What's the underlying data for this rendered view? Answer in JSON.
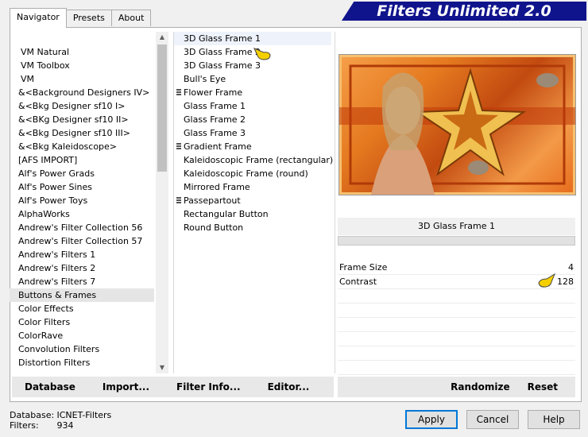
{
  "tabs": [
    {
      "label": "Navigator"
    },
    {
      "label": "Presets"
    },
    {
      "label": "About"
    }
  ],
  "banner": {
    "title": "Filters Unlimited 2.0"
  },
  "categories": [
    "VM Natural",
    "VM Toolbox",
    "VM",
    "&<Background Designers IV>",
    "&<Bkg Designer sf10 I>",
    "&<BKg Designer sf10 II>",
    "&<Bkg Designer sf10 III>",
    "&<Bkg Kaleidoscope>",
    "[AFS IMPORT]",
    "Alf's Power Grads",
    "Alf's Power Sines",
    "Alf's Power Toys",
    "AlphaWorks",
    "Andrew's Filter Collection 56",
    "Andrew's Filter Collection 57",
    "Andrew's Filters 1",
    "Andrew's Filters 2",
    "Andrew's Filters 7",
    "Buttons & Frames",
    "Color Effects",
    "Color Filters",
    "ColorRave",
    "Convolution Filters",
    "Distortion Filters"
  ],
  "selected_category": "Buttons & Frames",
  "filters": [
    {
      "label": "3D Glass Frame 1",
      "marked": false
    },
    {
      "label": "3D Glass Frame 2",
      "marked": false
    },
    {
      "label": "3D Glass Frame 3",
      "marked": false
    },
    {
      "label": "Bull's Eye",
      "marked": false
    },
    {
      "label": "Flower Frame",
      "marked": true
    },
    {
      "label": "Glass Frame 1",
      "marked": false
    },
    {
      "label": "Glass Frame 2",
      "marked": false
    },
    {
      "label": "Glass Frame 3",
      "marked": false
    },
    {
      "label": "Gradient Frame",
      "marked": true
    },
    {
      "label": "Kaleidoscopic Frame (rectangular)",
      "marked": false
    },
    {
      "label": "Kaleidoscopic Frame (round)",
      "marked": false
    },
    {
      "label": "Mirrored Frame",
      "marked": false
    },
    {
      "label": "Passepartout",
      "marked": true
    },
    {
      "label": "Rectangular Button",
      "marked": false
    },
    {
      "label": "Round Button",
      "marked": false
    }
  ],
  "selected_filter_name": "3D Glass Frame 1",
  "params": [
    {
      "name": "Frame Size",
      "value": "4"
    },
    {
      "name": "Contrast",
      "value": "128"
    }
  ],
  "bottom_left_buttons": {
    "database": "Database",
    "import": "Import...",
    "filter_info": "Filter Info...",
    "editor": "Editor..."
  },
  "bottom_right_buttons": {
    "randomize": "Randomize",
    "reset": "Reset"
  },
  "status": {
    "database_label": "Database:",
    "database_value": "ICNET-Filters",
    "filters_label": "Filters:",
    "filters_value": "934"
  },
  "dialog_buttons": {
    "apply": "Apply",
    "cancel": "Cancel",
    "help": "Help"
  },
  "colors": {
    "banner": "#10148c",
    "preview_accent": "#e57a20",
    "pointer": "#f5d000"
  }
}
